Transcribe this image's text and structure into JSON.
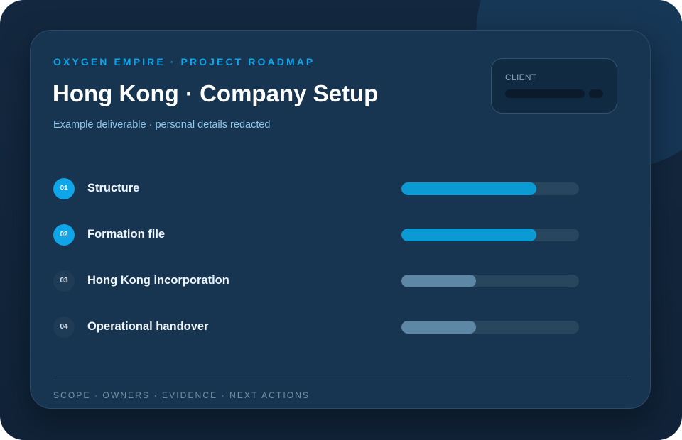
{
  "header": {
    "eyebrow": "OXYGEN EMPIRE · PROJECT ROADMAP",
    "title": "Hong Kong · Company Setup",
    "subtitle": "Example deliverable · personal details redacted"
  },
  "client": {
    "label": "CLIENT"
  },
  "steps": [
    {
      "number": "01",
      "label": "Structure",
      "progress": 0.76,
      "status": "active"
    },
    {
      "number": "02",
      "label": "Formation file",
      "progress": 0.76,
      "status": "active"
    },
    {
      "number": "03",
      "label": "Hong Kong incorporation",
      "progress": 0.42,
      "status": "pending"
    },
    {
      "number": "04",
      "label": "Operational handover",
      "progress": 0.42,
      "status": "pending"
    }
  ],
  "footer": {
    "text": "SCOPE · OWNERS · EVIDENCE · NEXT ACTIONS"
  },
  "colors": {
    "accent": "#0ea5e9",
    "active_fill": "#0a9ad4",
    "pending_fill": "#5e87a6",
    "track": "#29465f",
    "card_background": "#173450",
    "page_background": "#13283f"
  }
}
